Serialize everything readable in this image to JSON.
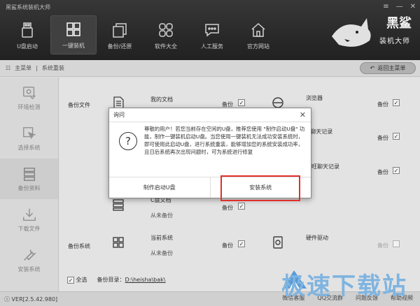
{
  "app": {
    "title": "黑鲨系统装机大师",
    "version": "VER[2.5.42.980]"
  },
  "window_controls": [
    "≡",
    "—",
    "✕"
  ],
  "nav": [
    {
      "label": "U盘启动",
      "icon": "usb-drive-icon"
    },
    {
      "label": "一键装机",
      "icon": "windows-icon",
      "active": true
    },
    {
      "label": "备份/还原",
      "icon": "copy-icon"
    },
    {
      "label": "软件大全",
      "icon": "grid-icon"
    },
    {
      "label": "人工服务",
      "icon": "chat-icon"
    },
    {
      "label": "官方网站",
      "icon": "home-icon"
    }
  ],
  "logo": {
    "text1": "黑鲨",
    "text2": "装机大师"
  },
  "breadcrumb": {
    "home": "主菜单",
    "current": "系统重装"
  },
  "back_button": "返回主菜单",
  "sidebar": [
    {
      "label": "环境检测",
      "icon": "gear-check-icon"
    },
    {
      "label": "选择系统",
      "icon": "cursor-icon"
    },
    {
      "label": "备份资料",
      "icon": "database-icon",
      "active": true
    },
    {
      "label": "下载文件",
      "icon": "download-icon"
    },
    {
      "label": "安装系统",
      "icon": "wrench-icon"
    }
  ],
  "main": {
    "backup_files_label": "备份文件",
    "backup_system_label": "备份系统",
    "items": {
      "my_docs": {
        "title": "我的文档",
        "size": "",
        "checkbox": "备份"
      },
      "browser": {
        "title": "浏览器",
        "checkbox": "备份"
      },
      "qq_chat": {
        "title": "Q聊天记录",
        "checkbox": "备份"
      },
      "wangwang": {
        "title": "旺旺聊天记录",
        "checkbox": "备份"
      },
      "c_drive": {
        "title": "C盘文档",
        "size": "从未备份",
        "checkbox": "备份"
      },
      "current_system": {
        "title": "当前系统",
        "size": "从未备份",
        "checkbox": "备份"
      },
      "hw_driver": {
        "title": "硬件驱动",
        "checkbox": "备份"
      }
    },
    "select_all": "全选",
    "backup_dir_label": "备份目录：",
    "backup_dir": "D:\\heisha\\bak\\"
  },
  "status_links": [
    "微信客服",
    "QQ交流群",
    "问题反馈",
    "帮助视频"
  ],
  "dialog": {
    "title": "询问",
    "message": "尊敬的用户！若您当前存在空闲的U盘，推荐您使用 \"制作启动U盘\" 功能，制作一键装机启动U盘。当您使用一键装机无法成功安装系统时，即可使用此启动U盘，进行系统重装，能够增加您的系统安装成功率，且日后系统再次出现问题时，可为系统进行修复",
    "btn_make_usb": "制作启动U盘",
    "btn_install": "安装系统"
  },
  "watermark": "极速下载站",
  "colors": {
    "highlight": "#e0302a",
    "watermark": "#7fb4e0",
    "titlebar": "#2a2a2a"
  }
}
